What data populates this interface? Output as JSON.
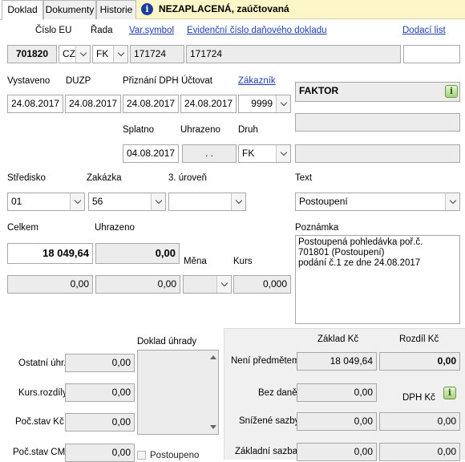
{
  "tabs": [
    "Doklad",
    "Dokumenty",
    "Historie"
  ],
  "status": {
    "icon": "info-icon",
    "text": "NEZAPLACENÁ, zaúčtovaná"
  },
  "header": {
    "cislo_eu_label": "Číslo EU",
    "rada_label": "Řada",
    "var_symbol_link": "Var.symbol",
    "evidencni_link": "Evidenční číslo daňového dokladu",
    "dodaci_list_link": "Dodací list"
  },
  "ident": {
    "cislo": "701820",
    "country": "CZ",
    "rada": "FK",
    "var_symbol": "171724",
    "evidencni_cislo": "171724",
    "dodaci_list": ""
  },
  "dates": {
    "vystaveno_label": "Vystaveno",
    "duzp_label": "DUZP",
    "priznani_label": "Přiznání DPH",
    "uctovat_label": "Účtovat",
    "zakaznik_link": "Zákazník",
    "vystaveno": "24.08.2017",
    "duzp": "24.08.2017",
    "priznani": "24.08.2017",
    "uctovat": "24.08.2017",
    "zakaznik_code": "9999",
    "splatno_label": "Splatno",
    "uhrazeno_label": "Uhrazeno",
    "druh_label": "Druh",
    "splatno": "04.08.2017",
    "uhrazeno": " .  . ",
    "druh": "FK"
  },
  "customer": {
    "name": "FAKTOR",
    "line2": "",
    "line3": ""
  },
  "stredisko": {
    "stredisko_label": "Středisko",
    "zakazka_label": "Zakázka",
    "uroven_label": "3. úroveň",
    "text_label": "Text",
    "stredisko": "01",
    "zakazka": "56",
    "uroven": "",
    "text": "Postoupení"
  },
  "totals": {
    "celkem_label": "Celkem",
    "uhrazeno_label": "Uhrazeno",
    "celkem": "18 049,64",
    "uhrazeno": "0,00",
    "mena_label": "Měna",
    "kurs_label": "Kurs",
    "val1": "0,00",
    "val2": "0,00",
    "mena": "",
    "kurs": "0,000"
  },
  "poznamka": {
    "label": "Poznámka",
    "lines": [
      "Postoupená pohledávka poř.č.",
      "701801 (Postoupení)",
      "podání č.1 ze dne 24.08.2017"
    ]
  },
  "uhrady": {
    "ostatni_label": "Ostatní úhr.",
    "ostatni": "0,00",
    "kurs_rozdily_label": "Kurs.rozdíly",
    "kurs_rozdily": "0,00",
    "poc_stav_kc_label": "Poč.stav Kč",
    "poc_stav_kc": "0,00",
    "poc_stav_cm_label": "Poč.stav CM",
    "poc_stav_cm": "0,00",
    "doklad_uhrady_label": "Doklad úhrady",
    "postoupeno_label": "Postoupeno"
  },
  "dph": {
    "zaklad_label": "Základ Kč",
    "rozdil_label": "Rozdíl Kč",
    "dph_label": "DPH Kč",
    "rows": [
      {
        "label": "Není předmětem",
        "zaklad": "18 049,64",
        "other": "0,00"
      },
      {
        "label": "Bez daně",
        "zaklad": "0,00",
        "other": ""
      },
      {
        "label": "Snížené sazby",
        "zaklad": "0,00",
        "other": "0,00"
      },
      {
        "label": "Základní sazba",
        "zaklad": "0,00",
        "other": "0,00"
      }
    ]
  }
}
